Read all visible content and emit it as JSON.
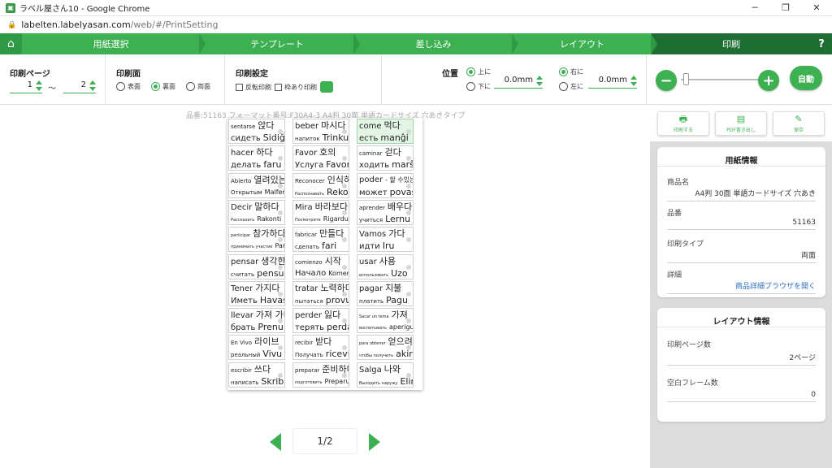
{
  "window": {
    "title": "ラベル屋さん10 - Google Chrome",
    "minimize": "─",
    "maximize": "❐",
    "close": "✕"
  },
  "address": {
    "host": "labelten.labelyasan.com",
    "path": "/web/#/PrintSetting"
  },
  "steps": [
    "用紙選択",
    "テンプレート",
    "差し込み",
    "レイアウト",
    "印刷"
  ],
  "help": "?",
  "toolbar": {
    "print_pages": {
      "title": "印刷ページ",
      "from": "1",
      "sep": "～",
      "to": "2"
    },
    "print_side": {
      "title": "印刷面",
      "options": [
        "表面",
        "裏面",
        "両面"
      ],
      "selected": "裏面"
    },
    "print_settings": {
      "title": "印刷設定",
      "mirror": "反転印刷",
      "frame": "枠あり印刷"
    },
    "position": {
      "title": "位置",
      "up": "上に",
      "down": "下に",
      "vertical_value": "0.0mm",
      "right": "右に",
      "left": "左に",
      "horizontal_value": "0.0mm"
    },
    "zoom": {
      "minus": "−",
      "plus": "+",
      "level": 0.03,
      "auto": "自動"
    }
  },
  "product_line": "品番:51163 フォーマット番号:F30A4-3 A4判 30面 単語カードサイズ 穴あきタイプ",
  "cards": [
    [
      [
        "sentarse",
        "앉다"
      ],
      [
        "сидеть",
        "Sidiğu"
      ]
    ],
    [
      [
        "beber",
        "마시다"
      ],
      [
        "напиток",
        "Trinku"
      ]
    ],
    [
      [
        "come",
        "먹다"
      ],
      [
        "есть",
        "manĝi"
      ]
    ],
    [
      [
        "hacer",
        "하다"
      ],
      [
        "делать",
        "faru"
      ]
    ],
    [
      [
        "Favor",
        "호의"
      ],
      [
        "Услуга",
        "Favoro"
      ]
    ],
    [
      [
        "caminar",
        "걷다"
      ],
      [
        "ходить",
        "marŝi"
      ]
    ],
    [
      [
        "Abierto",
        "열려있는"
      ],
      [
        "Открытым",
        "Malfermita"
      ]
    ],
    [
      [
        "Reconocer",
        "인식하다"
      ],
      [
        "Распознавать",
        "Rekoni"
      ]
    ],
    [
      [
        "poder",
        "- 할 수있는"
      ],
      [
        "может",
        "povas"
      ]
    ],
    [
      [
        "Decir",
        "말하다"
      ],
      [
        "Рассказать",
        "Rakonti"
      ]
    ],
    [
      [
        "Mira",
        "바라보다"
      ],
      [
        "Посмотрите",
        "Rigardu"
      ]
    ],
    [
      [
        "aprender",
        "배우다"
      ],
      [
        "учиться",
        "Lernu"
      ]
    ],
    [
      [
        "participar",
        "참가하다"
      ],
      [
        "принимать участие",
        "Partopreni"
      ]
    ],
    [
      [
        "fabricar",
        "만들다"
      ],
      [
        "сделать",
        "fari"
      ]
    ],
    [
      [
        "Vamos",
        "가다"
      ],
      [
        "идти",
        "Iru"
      ]
    ],
    [
      [
        "pensar",
        "생각한다"
      ],
      [
        "считать",
        "pensu"
      ]
    ],
    [
      [
        "comienzo",
        "시작"
      ],
      [
        "Начало",
        "Komencu"
      ]
    ],
    [
      [
        "usar",
        "사용"
      ],
      [
        "использовать",
        "Uzo"
      ]
    ],
    [
      [
        "Tener",
        "가지다"
      ],
      [
        "Иметь",
        "Havas"
      ]
    ],
    [
      [
        "tratar",
        "노력하다"
      ],
      [
        "пытаться",
        "provu"
      ]
    ],
    [
      [
        "pagar",
        "지불"
      ],
      [
        "платить",
        "Pagu"
      ]
    ],
    [
      [
        "llevar",
        "가져 가다"
      ],
      [
        "брать",
        "Prenu"
      ]
    ],
    [
      [
        "perder",
        "잃다"
      ],
      [
        "терять",
        "perdas"
      ]
    ],
    [
      [
        "Sacar un tema",
        "가져"
      ],
      [
        "воспитывать",
        "aperigu"
      ]
    ],
    [
      [
        "En Vivo",
        "라이브"
      ],
      [
        "реальный",
        "Vivu"
      ]
    ],
    [
      [
        "recibir",
        "받다"
      ],
      [
        "Получать",
        "ricevi"
      ]
    ],
    [
      [
        "para obtener",
        "얻으려면"
      ],
      [
        "чтобы получить",
        "akiri"
      ]
    ],
    [
      [
        "escribir",
        "쓰다"
      ],
      [
        "написать",
        "Skribu"
      ]
    ],
    [
      [
        "preparar",
        "준비하다"
      ],
      [
        "подготовить",
        "Preparu"
      ]
    ],
    [
      [
        "Salga",
        "나와"
      ],
      [
        "Выходить наружу",
        "Eliri"
      ]
    ]
  ],
  "pagination": {
    "indicator": "1/2"
  },
  "actions": {
    "print": "印刷する",
    "pdf": "PDF書き出し",
    "save": "保存"
  },
  "paper_info": {
    "title": "用紙情報",
    "product_name_label": "商品名",
    "product_name": "A4判 30面 単語カードサイズ 穴あき",
    "product_no_label": "品番",
    "product_no": "51163",
    "print_type_label": "印刷タイプ",
    "print_type": "両面",
    "detail_label": "詳細",
    "detail_link": "商品詳細ブラウザを開く"
  },
  "layout_info": {
    "title": "レイアウト情報",
    "print_pages_label": "印刷ページ数",
    "print_pages": "2ページ",
    "blank_frames_label": "空白フレーム数",
    "blank_frames": "0"
  },
  "colors": {
    "accent": "#3db052",
    "accent_dark": "#1e6e33",
    "highlight": "#e2f4e4"
  }
}
